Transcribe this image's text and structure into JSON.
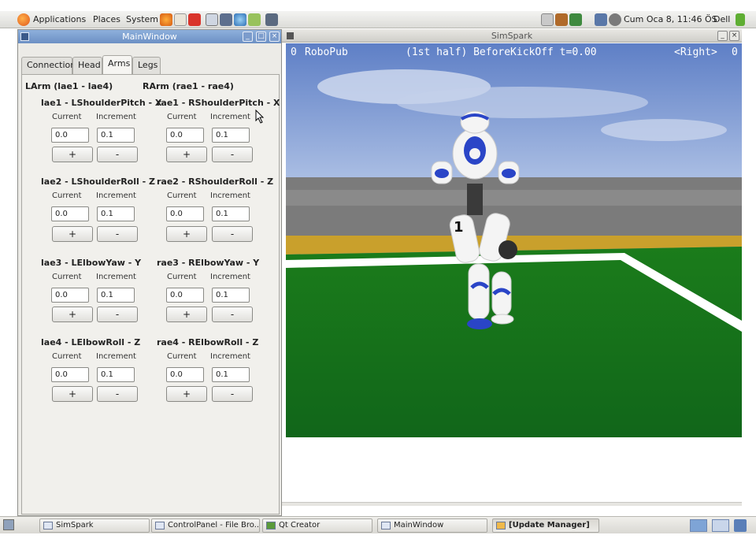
{
  "top_panel": {
    "menus": [
      "Applications",
      "Places",
      "System"
    ],
    "clock": "Cum Oca  8, 11:46 ÖS",
    "user": "Dell"
  },
  "main_window": {
    "title": "MainWindow",
    "tabs": [
      "Connection",
      "Head",
      "Arms",
      "Legs"
    ],
    "active_tab": "Arms",
    "groups": {
      "left": "LArm (lae1 - lae4)",
      "right": "RArm (rae1 - rae4)"
    },
    "joints_left": [
      {
        "title": "lae1 - LShoulderPitch - X",
        "current_label": "Current",
        "increment_label": "Increment",
        "current": "0.0",
        "increment": "0.1",
        "plus": "+",
        "minus": "-"
      },
      {
        "title": "lae2 - LShoulderRoll - Z",
        "current_label": "Current",
        "increment_label": "Increment",
        "current": "0.0",
        "increment": "0.1",
        "plus": "+",
        "minus": "-"
      },
      {
        "title": "lae3 - LElbowYaw - Y",
        "current_label": "Current",
        "increment_label": "Increment",
        "current": "0.0",
        "increment": "0.1",
        "plus": "+",
        "minus": "-"
      },
      {
        "title": "lae4 - LElbowRoll - Z",
        "current_label": "Current",
        "increment_label": "Increment",
        "current": "0.0",
        "increment": "0.1",
        "plus": "+",
        "minus": "-"
      }
    ],
    "joints_right": [
      {
        "title": "rae1 - RShoulderPitch - X",
        "current_label": "Current",
        "increment_label": "Increment",
        "current": "0.0",
        "increment": "0.1",
        "plus": "+",
        "minus": "-"
      },
      {
        "title": "rae2 - RShoulderRoll - Z",
        "current_label": "Current",
        "increment_label": "Increment",
        "current": "0.0",
        "increment": "0.1",
        "plus": "+",
        "minus": "-"
      },
      {
        "title": "rae3 - RElbowYaw - Y",
        "current_label": "Current",
        "increment_label": "Increment",
        "current": "0.0",
        "increment": "0.1",
        "plus": "+",
        "minus": "-"
      },
      {
        "title": "rae4 - RElbowRoll - Z",
        "current_label": "Current",
        "increment_label": "Increment",
        "current": "0.0",
        "increment": "0.1",
        "plus": "+",
        "minus": "-"
      }
    ]
  },
  "simspark": {
    "title": "SimSpark",
    "score_left": "0",
    "team_left": "RoboPub",
    "game_state": "(1st half) BeforeKickOff t=0.00",
    "team_right": "<Right>",
    "score_right": "0",
    "robot_number": "1"
  },
  "taskbar": {
    "tasks": [
      "SimSpark",
      "ControlPanel - File Bro...",
      "Qt Creator",
      "MainWindow",
      "[Update Manager]"
    ],
    "active_task": "[Update Manager]"
  },
  "colors": {
    "titlebar_active": "#6c90c4",
    "field_green": "#1f8a1f",
    "sky": "#6b88c9",
    "robot_blue": "#2a45c7"
  }
}
